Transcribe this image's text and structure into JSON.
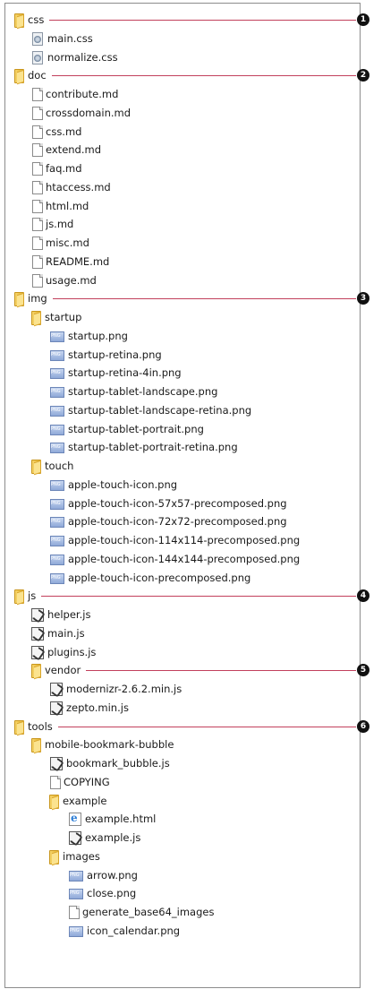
{
  "tree": [
    {
      "label": "css",
      "type": "folder",
      "depth": 0,
      "callout": "1"
    },
    {
      "label": "main.css",
      "type": "css",
      "depth": 1
    },
    {
      "label": "normalize.css",
      "type": "css",
      "depth": 1
    },
    {
      "label": "doc",
      "type": "folder",
      "depth": 0,
      "callout": "2"
    },
    {
      "label": "contribute.md",
      "type": "doc",
      "depth": 1
    },
    {
      "label": "crossdomain.md",
      "type": "doc",
      "depth": 1
    },
    {
      "label": "css.md",
      "type": "doc",
      "depth": 1
    },
    {
      "label": "extend.md",
      "type": "doc",
      "depth": 1
    },
    {
      "label": "faq.md",
      "type": "doc",
      "depth": 1
    },
    {
      "label": "htaccess.md",
      "type": "doc",
      "depth": 1
    },
    {
      "label": "html.md",
      "type": "doc",
      "depth": 1
    },
    {
      "label": "js.md",
      "type": "doc",
      "depth": 1
    },
    {
      "label": "misc.md",
      "type": "doc",
      "depth": 1
    },
    {
      "label": "README.md",
      "type": "doc",
      "depth": 1
    },
    {
      "label": "usage.md",
      "type": "doc",
      "depth": 1
    },
    {
      "label": "img",
      "type": "folder",
      "depth": 0,
      "callout": "3"
    },
    {
      "label": "startup",
      "type": "folder",
      "depth": 1
    },
    {
      "label": "startup.png",
      "type": "png",
      "depth": 2
    },
    {
      "label": "startup-retina.png",
      "type": "png",
      "depth": 2
    },
    {
      "label": "startup-retina-4in.png",
      "type": "png",
      "depth": 2
    },
    {
      "label": "startup-tablet-landscape.png",
      "type": "png",
      "depth": 2
    },
    {
      "label": "startup-tablet-landscape-retina.png",
      "type": "png",
      "depth": 2
    },
    {
      "label": "startup-tablet-portrait.png",
      "type": "png",
      "depth": 2
    },
    {
      "label": "startup-tablet-portrait-retina.png",
      "type": "png",
      "depth": 2
    },
    {
      "label": "touch",
      "type": "folder",
      "depth": 1
    },
    {
      "label": "apple-touch-icon.png",
      "type": "png",
      "depth": 2
    },
    {
      "label": "apple-touch-icon-57x57-precomposed.png",
      "type": "png",
      "depth": 2
    },
    {
      "label": "apple-touch-icon-72x72-precomposed.png",
      "type": "png",
      "depth": 2
    },
    {
      "label": "apple-touch-icon-114x114-precomposed.png",
      "type": "png",
      "depth": 2
    },
    {
      "label": "apple-touch-icon-144x144-precomposed.png",
      "type": "png",
      "depth": 2
    },
    {
      "label": "apple-touch-icon-precomposed.png",
      "type": "png",
      "depth": 2
    },
    {
      "label": "js",
      "type": "folder",
      "depth": 0,
      "callout": "4"
    },
    {
      "label": "helper.js",
      "type": "js",
      "depth": 1
    },
    {
      "label": "main.js",
      "type": "js",
      "depth": 1
    },
    {
      "label": "plugins.js",
      "type": "js",
      "depth": 1
    },
    {
      "label": "vendor",
      "type": "folder",
      "depth": 1,
      "callout": "5"
    },
    {
      "label": "modernizr-2.6.2.min.js",
      "type": "js",
      "depth": 2
    },
    {
      "label": "zepto.min.js",
      "type": "js",
      "depth": 2
    },
    {
      "label": "tools",
      "type": "folder",
      "depth": 0,
      "callout": "6"
    },
    {
      "label": "mobile-bookmark-bubble",
      "type": "folder",
      "depth": 1
    },
    {
      "label": "bookmark_bubble.js",
      "type": "js",
      "depth": 2
    },
    {
      "label": "COPYING",
      "type": "doc",
      "depth": 2
    },
    {
      "label": "example",
      "type": "folder",
      "depth": 2
    },
    {
      "label": "example.html",
      "type": "html",
      "depth": 3
    },
    {
      "label": "example.js",
      "type": "js",
      "depth": 3
    },
    {
      "label": "images",
      "type": "folder",
      "depth": 2
    },
    {
      "label": "arrow.png",
      "type": "png",
      "depth": 3
    },
    {
      "label": "close.png",
      "type": "png",
      "depth": 3
    },
    {
      "label": "generate_base64_images",
      "type": "doc",
      "depth": 3
    },
    {
      "label": "icon_calendar.png",
      "type": "png",
      "depth": 3
    }
  ],
  "colors": {
    "callout_line": "#c2405c",
    "callout_badge": "#111111",
    "folder": "#e7b52c"
  }
}
